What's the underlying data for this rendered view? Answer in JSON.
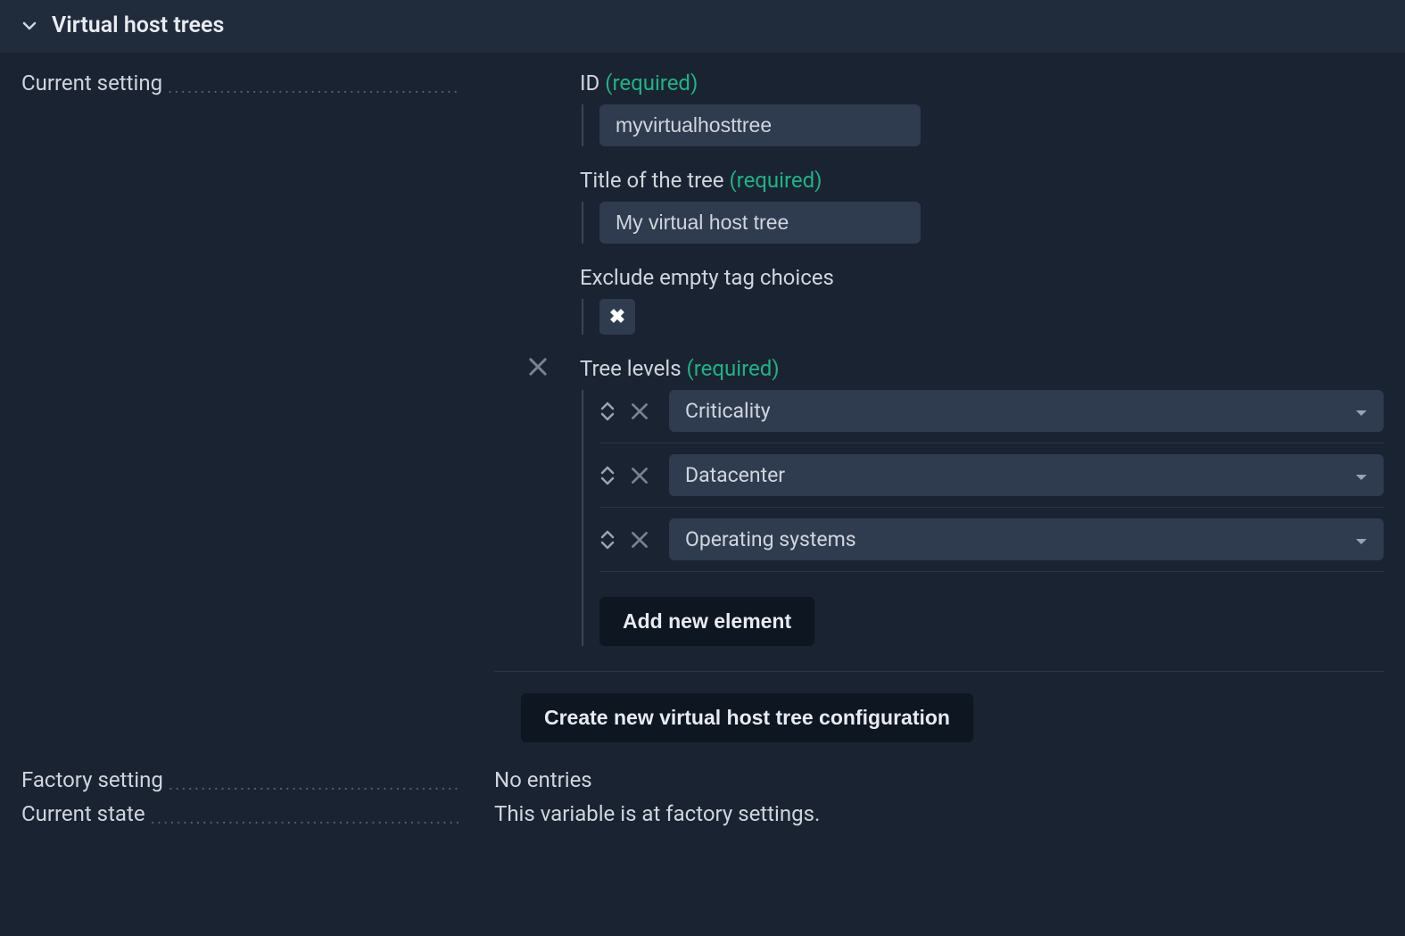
{
  "header": {
    "title": "Virtual host trees"
  },
  "current_setting": {
    "label": "Current setting",
    "id": {
      "label": "ID",
      "required": "(required)",
      "value": "myvirtualhosttree"
    },
    "title_field": {
      "label": "Title of the tree",
      "required": "(required)",
      "value": "My virtual host tree"
    },
    "exclude_empty": {
      "label": "Exclude empty tag choices",
      "checked": true
    },
    "tree_levels": {
      "label": "Tree levels",
      "required": "(required)",
      "items": [
        {
          "value": "Criticality"
        },
        {
          "value": "Datacenter"
        },
        {
          "value": "Operating systems"
        }
      ],
      "add_button": "Add new element"
    },
    "create_button": "Create new virtual host tree configuration"
  },
  "factory_setting": {
    "label": "Factory setting",
    "value": "No entries"
  },
  "current_state": {
    "label": "Current state",
    "value": "This variable is at factory settings."
  }
}
